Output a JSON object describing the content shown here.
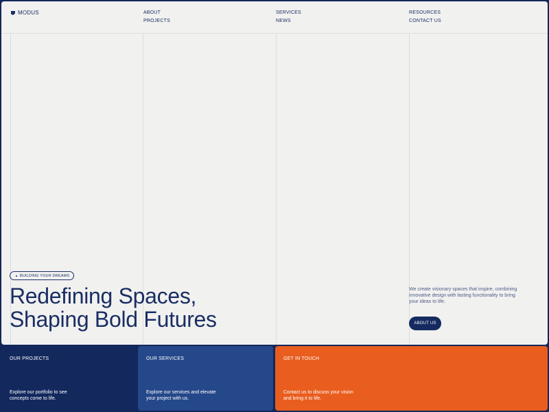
{
  "brand": {
    "name": "MODUS",
    "icon": "logo-mark-icon"
  },
  "nav": {
    "col1": [
      "ABOUT",
      "PROJECTS"
    ],
    "col2": [
      "SERVICES",
      "NEWS"
    ],
    "col3": [
      "RESOURCES",
      "CONTACT US"
    ]
  },
  "hero": {
    "badge": "BUILDING YOUR DREAMS",
    "headline_line1": "Redefining Spaces,",
    "headline_line2": "Shaping Bold Futures",
    "intro": "We create visionary spaces that inspire, combining innovative design with lasting functionality to bring your ideas to life.",
    "cta_label": "ABOUT US"
  },
  "cards": [
    {
      "title": "OUR PROJECTS",
      "text": "Explore our portfolio to see concepts come to life."
    },
    {
      "title": "OUR SERVICES",
      "text": "Explore our services and elevate your project with us."
    },
    {
      "title": "GET IN TOUCH",
      "text": "Contact us to discuss your vision and bring it to life."
    }
  ],
  "colors": {
    "navy": "#1a2e63",
    "card_projects": "#13295e",
    "card_services": "#24488a",
    "card_contact": "#e95d1f",
    "hero_background": "#f1f1f0"
  }
}
